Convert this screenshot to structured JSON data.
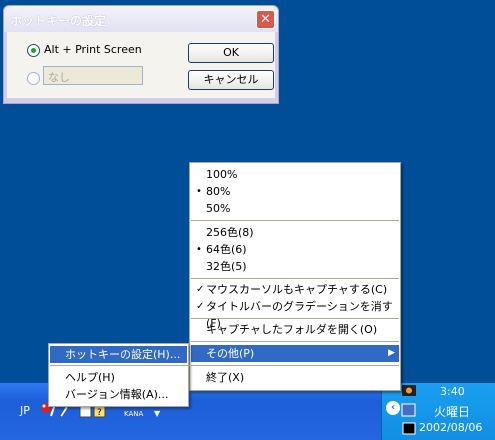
{
  "dialog": {
    "title": "ホットキーの設定",
    "close_symbol": "✕",
    "option1_label": "Alt + Print Screen",
    "option2_placeholder": "なし",
    "ok_label": "OK",
    "cancel_label": "キャンセル"
  },
  "main_menu": {
    "items": [
      {
        "label": "100%",
        "mark": ""
      },
      {
        "label": "80%",
        "mark": "•"
      },
      {
        "label": "50%",
        "mark": ""
      },
      {
        "label": "256色(8)",
        "mark": ""
      },
      {
        "label": "64色(6)",
        "mark": "•"
      },
      {
        "label": "32色(5)",
        "mark": ""
      },
      {
        "label": "マウスカーソルもキャプチャする(C)",
        "mark": "✓"
      },
      {
        "label": "タイトルバーのグラデーションを消す(F)",
        "mark": "✓"
      },
      {
        "label": "キャプチャしたフォルダを開く(O)",
        "mark": ""
      },
      {
        "label": "その他(P)",
        "mark": "",
        "arrow": "▶"
      },
      {
        "label": "終了(X)",
        "mark": ""
      }
    ]
  },
  "sub_menu": {
    "items": [
      {
        "label": "ホットキーの設定(H)..."
      },
      {
        "label": "ヘルプ(H)"
      },
      {
        "label": "バージョン情報(A)..."
      }
    ]
  },
  "taskbar": {
    "lang": "JP",
    "ime_mode": "KANA",
    "ime_arrow": "▼",
    "tray_chevron": "‹",
    "clock_time": "3:40",
    "clock_day": "火曜日",
    "clock_date": "2002/08/06"
  },
  "colors": {
    "desktop": "#004e98",
    "menu_highlight": "#316ac5",
    "taskbar": "#2366e0"
  }
}
